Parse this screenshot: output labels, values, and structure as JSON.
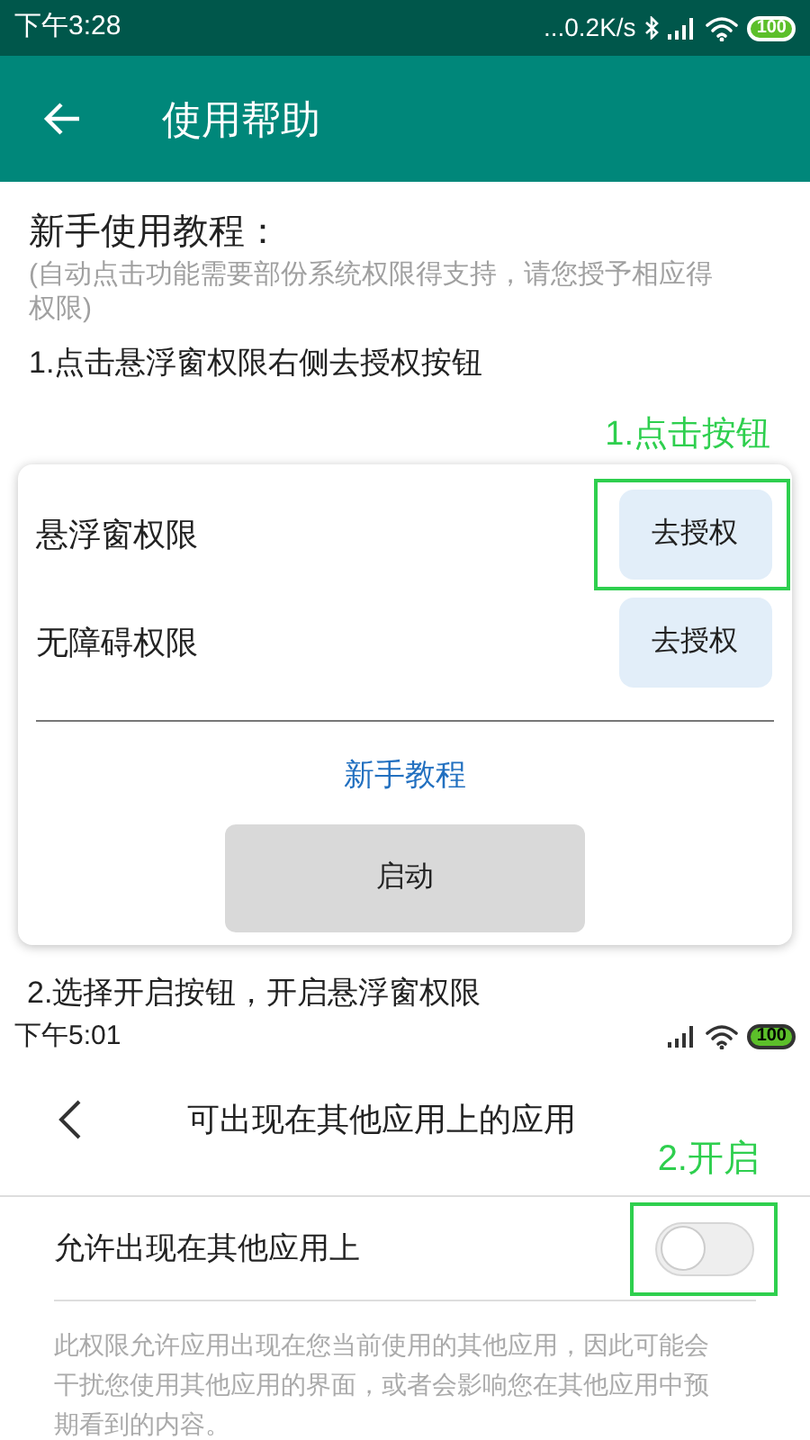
{
  "status_bar": {
    "time": "下午3:28",
    "net_speed": "...0.2K/s",
    "battery": "100"
  },
  "app_bar": {
    "title": "使用帮助"
  },
  "heading": "新手使用教程：",
  "note": "(自动点击功能需要部份系统权限得支持，请您授予相应得权限)",
  "step_1": "1.点击悬浮窗权限右侧去授权按钮",
  "callout_1": "1.点击按钮",
  "card": {
    "permissions": [
      {
        "label": "悬浮窗权限",
        "button": "去授权",
        "highlighted": true
      },
      {
        "label": "无障碍权限",
        "button": "去授权",
        "highlighted": false
      }
    ],
    "link": "新手教程",
    "start_button": "启动"
  },
  "step_2": "2.选择开启按钮，开启悬浮窗权限",
  "embedded_screen": {
    "time": "下午5:01",
    "battery": "100",
    "title": "可出现在其他应用上的应用",
    "callout_2": "2.开启",
    "setting": {
      "label": "允许出现在其他应用上",
      "on": false,
      "highlighted": true
    },
    "description": "此权限允许应用出现在您当前使用的其他应用，因此可能会干扰您使用其他应用的界面，或者会影响您在其他应用中预期看到的内容。"
  }
}
